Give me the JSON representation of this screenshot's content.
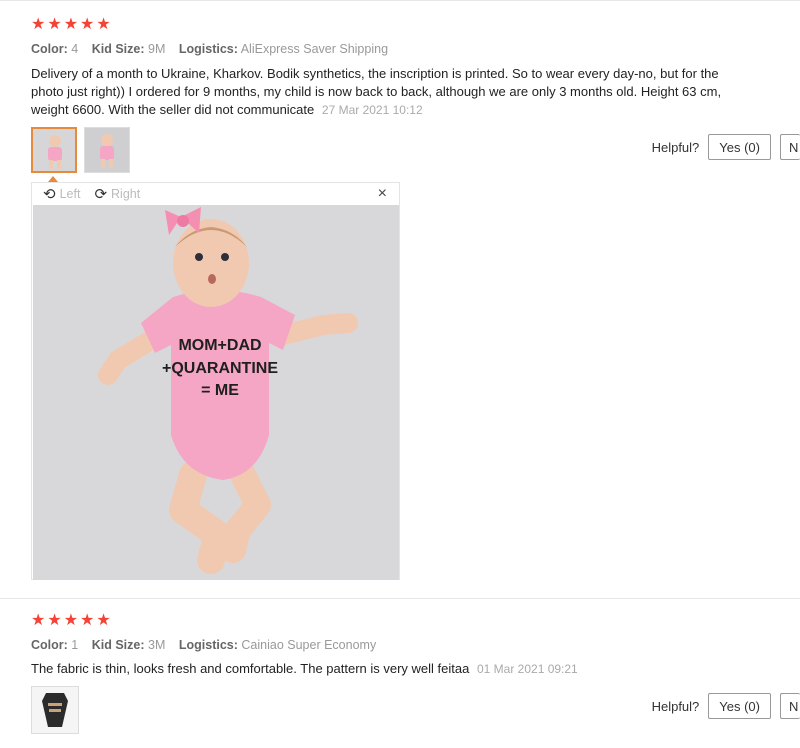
{
  "reviews": [
    {
      "rating": 5,
      "color_label": "Color:",
      "color_value": "4",
      "size_label": "Kid Size:",
      "size_value": "9M",
      "logistics_label": "Logistics:",
      "logistics_value": "AliExpress Saver Shipping",
      "text": "Delivery of a month to Ukraine, Kharkov. Bodik synthetics, the inscription is printed. So to wear every day-no, but for the photo just right)) I ordered for 9 months, my child is now back to back, although we are only 3 months old. Height 63 cm, weight 6600. With the seller did not communicate",
      "date": "27 Mar 2021 10:12",
      "helpful_label": "Helpful?",
      "yes_label": "Yes (0)",
      "no_label": "N"
    },
    {
      "rating": 5,
      "color_label": "Color:",
      "color_value": "1",
      "size_label": "Kid Size:",
      "size_value": "3M",
      "logistics_label": "Logistics:",
      "logistics_value": "Cainiao Super Economy",
      "text": "The fabric is thin, looks fresh and comfortable. The pattern is very well feitaa",
      "date": "01 Mar 2021 09:21",
      "helpful_label": "Helpful?",
      "yes_label": "Yes (0)",
      "no_label": "N"
    }
  ],
  "viewer": {
    "left_label": "Left",
    "right_label": "Right",
    "close_glyph": "×",
    "shirt_text_line1": "MOM+DAD",
    "shirt_text_line2": "+QUARANTINE",
    "shirt_text_line3": "= ME"
  },
  "icons": {
    "star": "★",
    "rotate_left": "⟲",
    "rotate_right": "⟳"
  },
  "colors": {
    "star": "#f44336",
    "active_thumb": "#e78a3b",
    "onesie": "#f4a6c4"
  }
}
